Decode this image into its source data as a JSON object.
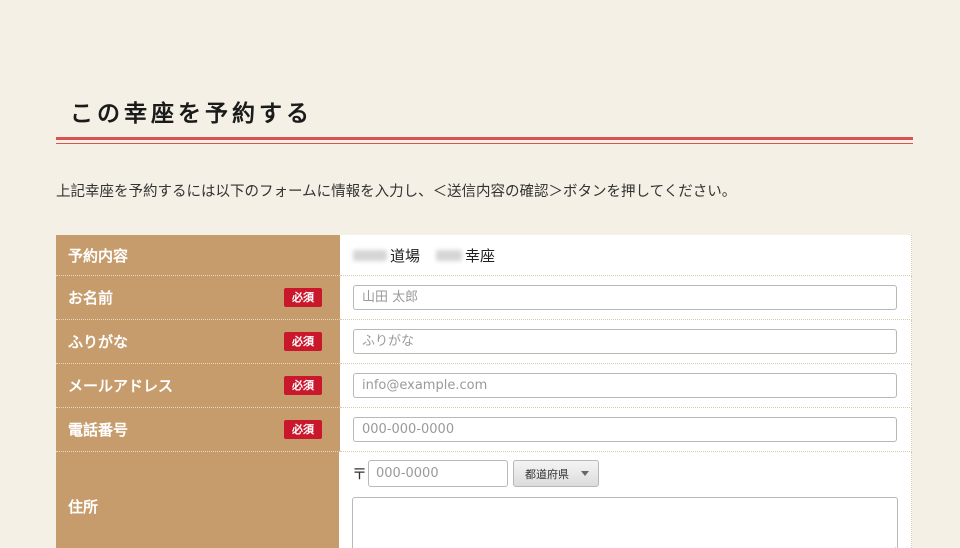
{
  "page": {
    "title": "この幸座を予約する",
    "intro": "上記幸座を予約するには以下のフォームに情報を入力し、＜送信内容の確認＞ボタンを押してください。"
  },
  "form": {
    "required_badge": "必須",
    "reservation": {
      "label": "予約内容",
      "dojo_suffix": "道場",
      "course_suffix": "幸座"
    },
    "name": {
      "label": "お名前",
      "placeholder": "山田 太郎"
    },
    "furigana": {
      "label": "ふりがな",
      "placeholder": "ふりがな"
    },
    "email": {
      "label": "メールアドレス",
      "placeholder": "info@example.com"
    },
    "phone": {
      "label": "電話番号",
      "placeholder": "000-000-0000"
    },
    "address": {
      "label": "住所",
      "postal_mark": "〒",
      "postal_placeholder": "000-0000",
      "prefecture_selected": "都道府県"
    }
  },
  "colors": {
    "label_bg": "#c69c6d",
    "badge_bg": "#c9172c",
    "rule": "#d9534f",
    "page_bg": "#f5f0e6"
  }
}
